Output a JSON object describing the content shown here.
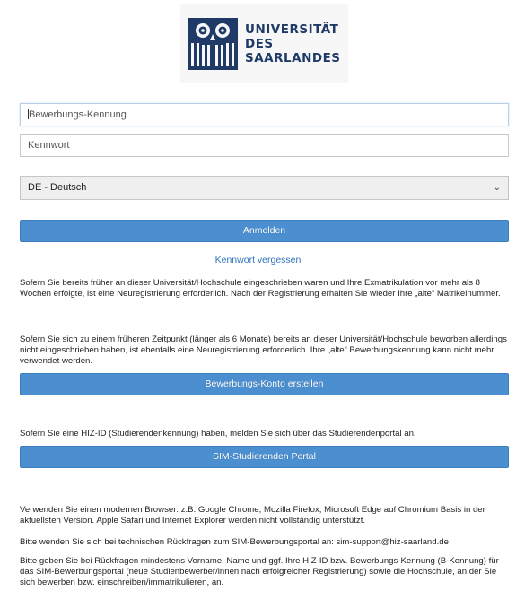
{
  "logo": {
    "line1": "UNIVERSITÄT",
    "line2": "DES",
    "line3": "SAARLANDES",
    "brand_color": "#1f3a66"
  },
  "form": {
    "username_placeholder": "Bewerbungs-Kennung",
    "password_placeholder": "Kennwort",
    "language_selected": "DE - Deutsch",
    "login_label": "Anmelden",
    "forgot_label": "Kennwort vergessen"
  },
  "info": {
    "para1": "Sofern Sie bereits früher an dieser Universität/Hochschule eingeschrieben waren und Ihre Exmatrikulation vor mehr als 8 Wochen erfolgte, ist eine Neuregistrierung erforderlich. Nach der Registrierung erhalten Sie wieder Ihre „alte“ Matrikelnummer.",
    "para2": "Sofern Sie sich zu einem früheren Zeitpunkt (länger als 6 Monate) bereits an dieser Universität/Hochschule beworben allerdings nicht eingeschrieben haben, ist ebenfalls eine Neuregistrierung erforderlich. Ihre „alte“ Bewerbungskennung kann nicht mehr verwendet werden.",
    "create_account_label": "Bewerbungs-Konto erstellen",
    "para3": "Sofern Sie eine HIZ-ID (Studierendenkennung) haben, melden Sie sich über das Studierendenportal an.",
    "portal_label": "SIM-Studierenden Portal",
    "para4": "Verwenden Sie einen modernen Browser: z.B. Google Chrome, Mozilla Firefox, Microsoft Edge auf Chromium Basis in der aktuellsten Version. Apple Safari und Internet Explorer werden nicht vollständig unterstützt.",
    "para5": "Bitte wenden Sie sich bei technischen Rückfragen zum SIM-Bewerbungsportal an: sim-support@hiz-saarland.de",
    "para6": "Bitte geben Sie bei Rückfragen mindestens Vorname, Name und ggf. Ihre HIZ-ID bzw. Bewerbungs-Kennung (B-Kennung) für das SIM-Bewerbungsportal (neue Studienbewerber/innen nach erfolgreicher Registrierung) sowie die Hochschule, an der Sie sich bewerben bzw. einschreiben/immatrikulieren, an."
  },
  "colors": {
    "button": "#4c8fd1",
    "link": "#2f73bb"
  }
}
